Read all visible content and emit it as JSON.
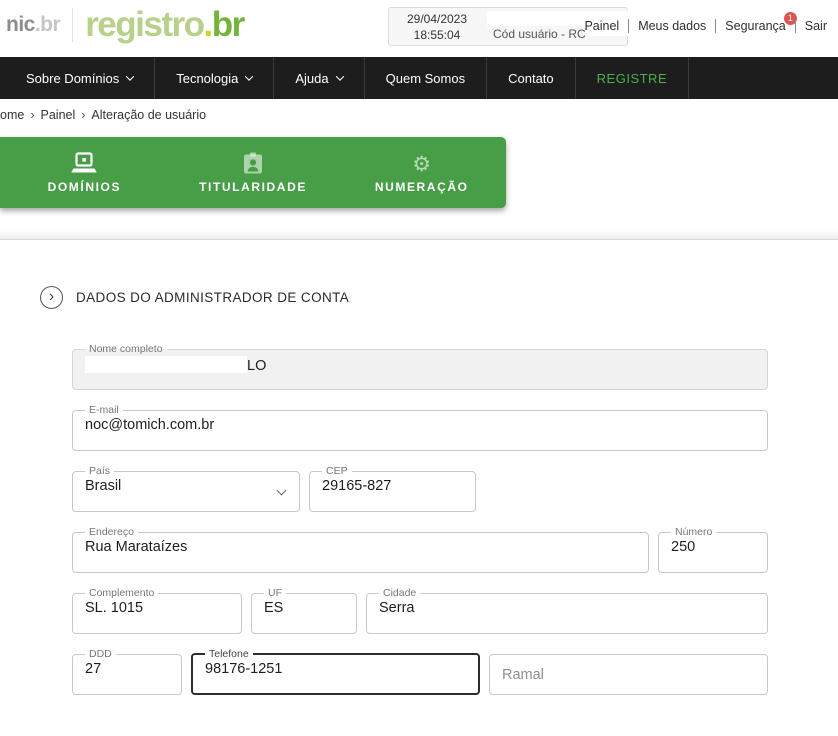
{
  "header": {
    "logo": {
      "nic": "nic",
      "nic_suffix": ".br",
      "registro": "registr",
      "o": "o",
      "dot": ".",
      "br": "br"
    },
    "session": {
      "date": "29/04/2023",
      "time": "18:55:04",
      "user_code_label": "Cód usuário - RC"
    },
    "links": [
      {
        "label": "Painel"
      },
      {
        "label": "Meus dados"
      },
      {
        "label": "Segurança",
        "badge": "1"
      },
      {
        "label": "Sair"
      }
    ]
  },
  "nav": {
    "items": [
      {
        "label": "Sobre Domínios",
        "has_dropdown": true
      },
      {
        "label": "Tecnologia",
        "has_dropdown": true
      },
      {
        "label": "Ajuda",
        "has_dropdown": true
      },
      {
        "label": "Quem Somos",
        "has_dropdown": false
      },
      {
        "label": "Contato",
        "has_dropdown": false
      }
    ],
    "registre": "REGISTRE"
  },
  "breadcrumb": {
    "separator": "›",
    "items": [
      "ome",
      "Painel",
      "Alteração de usuário"
    ]
  },
  "tabs": {
    "domains": {
      "label": "DOMÍNIOS",
      "icon": "laptop-icon",
      "active": true
    },
    "ownership": {
      "label": "TITULARIDADE",
      "icon": "id-badge-icon",
      "active": false
    },
    "numbering": {
      "label": "NUMERAÇÃO",
      "icon": "gear-icon",
      "active": false,
      "gear_glyph": "⚙"
    }
  },
  "section": {
    "title": "DADOS DO ADMINISTRADOR DE CONTA",
    "chevron": "›"
  },
  "form": {
    "nome_completo": {
      "label": "Nome completo",
      "visible_value": "LO",
      "redacted": true,
      "disabled": true
    },
    "email": {
      "label": "E-mail",
      "value": "noc@tomich.com.br"
    },
    "pais": {
      "label": "País",
      "value": "Brasil",
      "type": "select"
    },
    "cep": {
      "label": "CEP",
      "value": "29165-827"
    },
    "endereco": {
      "label": "Endereço",
      "value": "Rua Marataízes"
    },
    "numero": {
      "label": "Número",
      "value": "250"
    },
    "complemento": {
      "label": "Complemento",
      "value": "SL. 1015"
    },
    "uf": {
      "label": "UF",
      "value": "ES"
    },
    "cidade": {
      "label": "Cidade",
      "value": "Serra"
    },
    "ddd": {
      "label": "DDD",
      "value": "27"
    },
    "telefone": {
      "label": "Telefone",
      "value": "98176-1251",
      "focused": true
    },
    "ramal": {
      "placeholder": "Ramal"
    }
  },
  "colors": {
    "tabbar_green": "#479e47",
    "registre_green": "#4caf50",
    "nav_bg": "#1d1d1d",
    "badge_red": "#e0524d",
    "logo_light_green": "#b7d08a",
    "logo_dark_green": "#74b33c",
    "logo_dot_yellow": "#c6d930"
  }
}
